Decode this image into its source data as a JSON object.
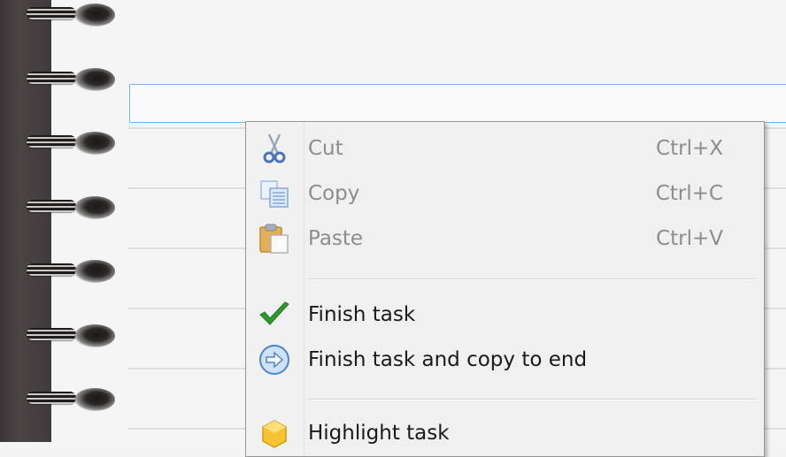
{
  "context_menu": {
    "items": [
      {
        "label": "Cut",
        "shortcut": "Ctrl+X",
        "icon": "scissors-icon",
        "enabled": false
      },
      {
        "label": "Copy",
        "shortcut": "Ctrl+C",
        "icon": "copy-icon",
        "enabled": false
      },
      {
        "label": "Paste",
        "shortcut": "Ctrl+V",
        "icon": "paste-icon",
        "enabled": false
      },
      {
        "label": "Finish task",
        "shortcut": "",
        "icon": "checkmark-icon",
        "enabled": true
      },
      {
        "label": "Finish task and copy to end",
        "shortcut": "",
        "icon": "arrow-right-circle-icon",
        "enabled": true
      },
      {
        "label": "Highlight task",
        "shortcut": "",
        "icon": "highlight-icon",
        "enabled": true
      }
    ]
  },
  "task_input": {
    "value": ""
  },
  "colors": {
    "binding": "#3f3a3b",
    "input_border": "#7eb4ea",
    "check_green": "#2e9a2e",
    "arrow_blue": "#4a86d8",
    "highlight_yellow": "#f5c430"
  }
}
